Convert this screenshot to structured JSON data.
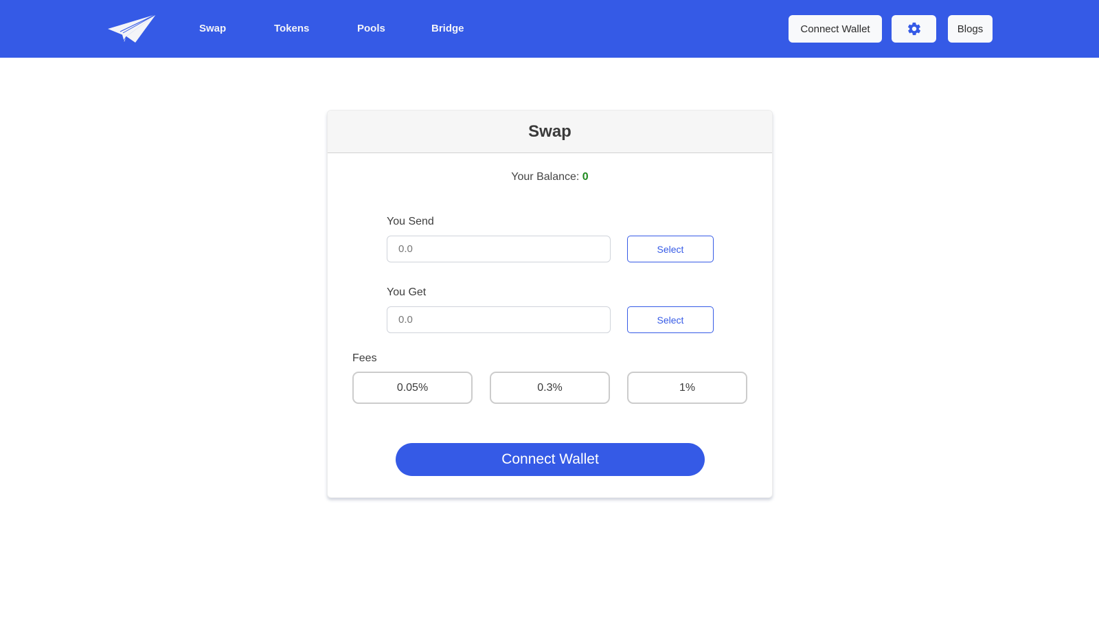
{
  "nav": {
    "logo_icon": "paper-plane-icon",
    "links": [
      {
        "label": "Swap"
      },
      {
        "label": "Tokens"
      },
      {
        "label": "Pools"
      },
      {
        "label": "Bridge"
      }
    ],
    "connect_wallet_label": "Connect Wallet",
    "settings_icon": "gear-icon",
    "blogs_label": "Blogs"
  },
  "swap": {
    "title": "Swap",
    "balance_label": "Your Balance:",
    "balance_value": "0",
    "send": {
      "label": "You Send",
      "placeholder": "0.0",
      "select_label": "Select"
    },
    "get": {
      "label": "You Get",
      "placeholder": "0.0",
      "select_label": "Select"
    },
    "fees": {
      "label": "Fees",
      "options": [
        "0.05%",
        "0.3%",
        "1%"
      ]
    },
    "cta_label": "Connect Wallet"
  },
  "colors": {
    "brand": "#355ae6",
    "balance_positive": "#1f8a1f"
  }
}
